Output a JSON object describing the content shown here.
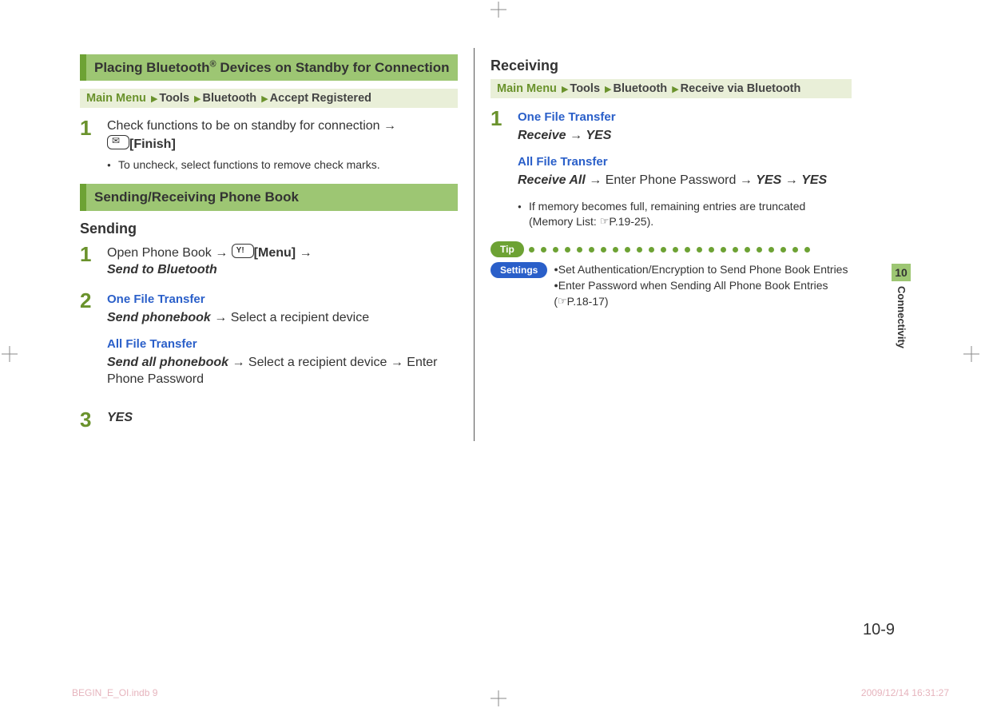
{
  "left": {
    "band1": "Placing Bluetooth® Devices on Standby for Connection",
    "crumb1": {
      "mm": "Main Menu",
      "p1": "Tools",
      "p2": "Bluetooth",
      "p3": "Accept Registered"
    },
    "step1_text": "Check functions to be on standby for connection ",
    "step1_finish": "[Finish]",
    "step1_note": "To uncheck, select functions to remove check marks.",
    "band2": "Sending/Receiving Phone Book",
    "sub_sending": "Sending",
    "s1_pre": "Open Phone Book ",
    "s1_menu": "[Menu]",
    "s1_post": "Send to Bluetooth",
    "s2_one_label": "One File Transfer",
    "s2_one_action": "Send phonebook",
    "s2_one_post": "Select a recipient device",
    "s2_all_label": "All File Transfer",
    "s2_all_action": "Send all phonebook",
    "s2_all_mid": "Select a recipient device",
    "s2_all_post": "Enter Phone Password",
    "s3": "YES"
  },
  "right": {
    "sub_receiving": "Receiving",
    "crumb": {
      "mm": "Main Menu",
      "p1": "Tools",
      "p2": "Bluetooth",
      "p3": "Receive via Bluetooth"
    },
    "one_label": "One File Transfer",
    "one_a": "Receive",
    "one_b": "YES",
    "all_label": "All File Transfer",
    "all_a": "Receive All",
    "all_mid": "Enter Phone Password",
    "all_b": "YES",
    "all_c": "YES",
    "memnote": "If memory becomes full, remaining entries are truncated (Memory List: ",
    "memref": "P.19-25).",
    "tip": "Tip",
    "settings": "Settings",
    "set1": "Set Authentication/Encryption to Send Phone Book Entries",
    "set2": "Enter Password when Sending All Phone Book Entries",
    "setref": "P.18-17)"
  },
  "tab": {
    "num": "10",
    "label": "Connectivity"
  },
  "pagenum": "10-9",
  "footer": {
    "left": "BEGIN_E_OI.indb   9",
    "right": "2009/12/14   16:31:27"
  },
  "arrow": "→"
}
